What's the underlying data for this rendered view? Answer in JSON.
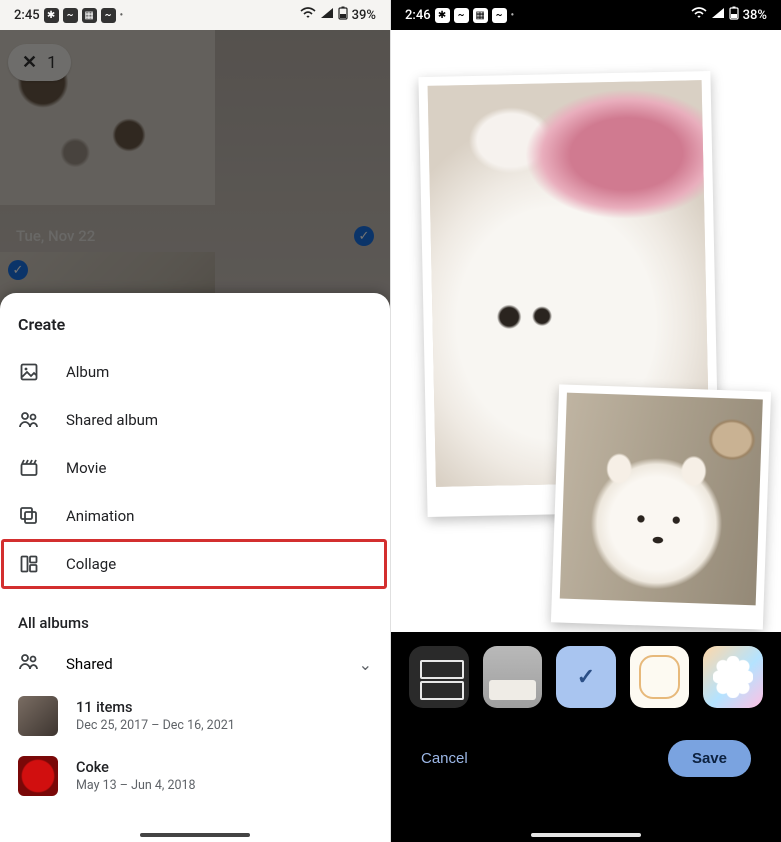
{
  "left": {
    "statusbar": {
      "time": "2:45",
      "battery": "39%"
    },
    "selection_count": "1",
    "date_header": "Tue, Nov 22",
    "sheet": {
      "create_title": "Create",
      "items": [
        {
          "icon": "album-icon",
          "label": "Album"
        },
        {
          "icon": "shared-icon",
          "label": "Shared album"
        },
        {
          "icon": "movie-icon",
          "label": "Movie"
        },
        {
          "icon": "animation-icon",
          "label": "Animation"
        },
        {
          "icon": "collage-icon",
          "label": "Collage"
        }
      ],
      "all_albums_title": "All albums",
      "shared_label": "Shared",
      "albums": [
        {
          "title": "11 items",
          "subtitle": "Dec 25, 2017 – Dec 16, 2021"
        },
        {
          "title": "Coke",
          "subtitle": "May 13 – Jun 4, 2018"
        }
      ]
    }
  },
  "right": {
    "statusbar": {
      "time": "2:46",
      "battery": "38%"
    },
    "cancel_label": "Cancel",
    "save_label": "Save",
    "style_names": [
      "two-stack",
      "muted",
      "polaroid-selected",
      "rounded-white",
      "flower"
    ]
  }
}
